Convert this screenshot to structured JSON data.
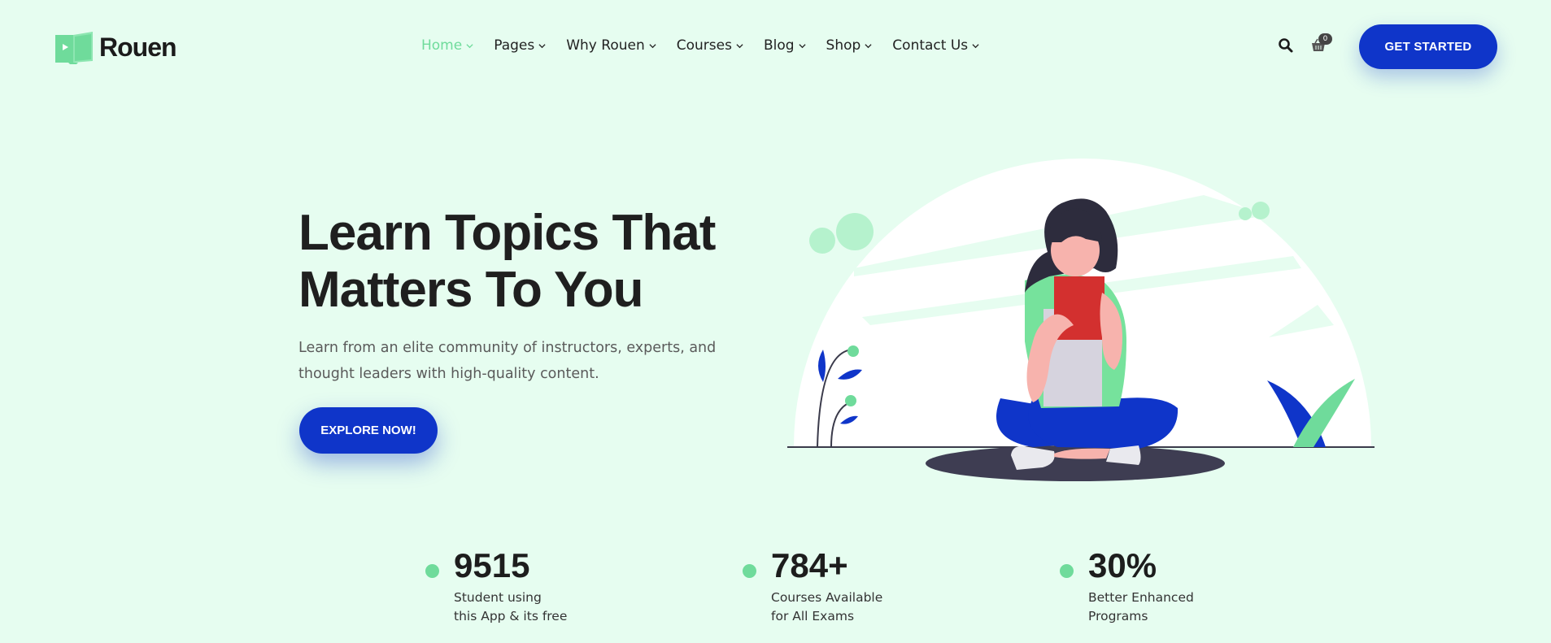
{
  "brand": {
    "name": "Rouen",
    "accent": "#6fdb9b",
    "primary": "#0f35c9",
    "background": "#e6fdf0"
  },
  "nav": {
    "items": [
      {
        "label": "Home",
        "active": true
      },
      {
        "label": "Pages",
        "active": false
      },
      {
        "label": "Why Rouen",
        "active": false
      },
      {
        "label": "Courses",
        "active": false
      },
      {
        "label": "Blog",
        "active": false
      },
      {
        "label": "Shop",
        "active": false
      },
      {
        "label": "Contact Us",
        "active": false
      }
    ]
  },
  "header": {
    "search_icon": "search-icon",
    "cart_icon": "cart-icon",
    "cart_count": "0",
    "cta_label": "GET STARTED"
  },
  "hero": {
    "title_line1": "Learn Topics That",
    "title_line2": "Matters To You",
    "subtitle_line1": "Learn from an elite community of instructors, experts, and",
    "subtitle_line2": "thought leaders with high-quality content.",
    "cta_label": "EXPLORE NOW!"
  },
  "stats": [
    {
      "value": "9515",
      "label_line1": "Student using",
      "label_line2": "this App & its free"
    },
    {
      "value": "784+",
      "label_line1": "Courses Available",
      "label_line2": "for All Exams"
    },
    {
      "value": "30%",
      "label_line1": "Better Enhanced",
      "label_line2": "Programs"
    }
  ]
}
